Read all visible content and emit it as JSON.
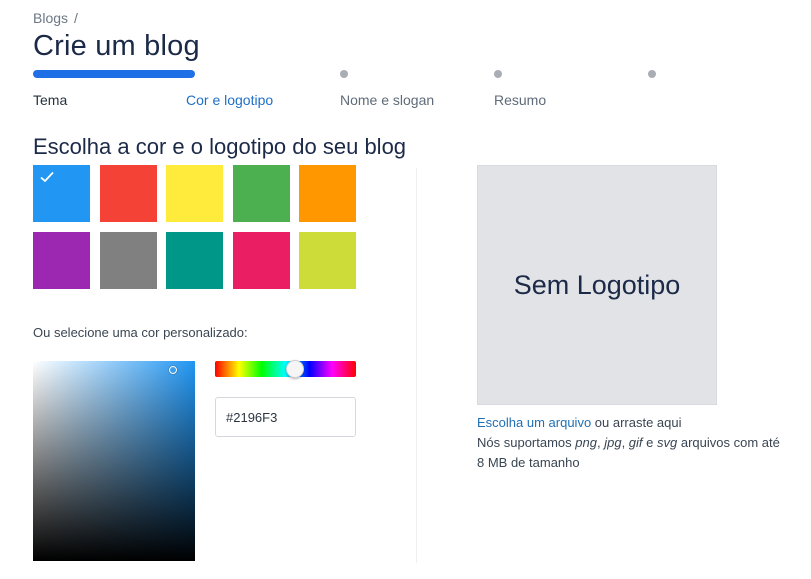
{
  "breadcrumb": {
    "item": "Blogs",
    "separator": "/"
  },
  "page_title": "Crie um blog",
  "steps": [
    {
      "label": "Tema",
      "state": "done"
    },
    {
      "label": "Cor e logotipo",
      "state": "active"
    },
    {
      "label": "Nome e slogan",
      "state": "upcoming"
    },
    {
      "label": "Resumo",
      "state": "upcoming"
    }
  ],
  "progress_fraction": 0.25,
  "section_title": "Escolha a cor e o logotipo do seu blog",
  "swatches": [
    {
      "color": "#2196F3",
      "selected": true
    },
    {
      "color": "#F44336",
      "selected": false
    },
    {
      "color": "#FFEB3B",
      "selected": false
    },
    {
      "color": "#4CAF50",
      "selected": false
    },
    {
      "color": "#FF9800",
      "selected": false
    },
    {
      "color": "#9C27B0",
      "selected": false
    },
    {
      "color": "#808080",
      "selected": false
    },
    {
      "color": "#009688",
      "selected": false
    },
    {
      "color": "#E91E63",
      "selected": false
    },
    {
      "color": "#CDDC39",
      "selected": false
    }
  ],
  "custom_color_label": "Ou selecione uma cor personalizado:",
  "hex_value": "#2196F3",
  "logo_placeholder": "Sem Logotipo",
  "upload": {
    "link": "Escolha um arquivo",
    "suffix": " ou arraste aqui",
    "line2_prefix": "Nós suportamos ",
    "fmt1": "png",
    "comma1": ", ",
    "fmt2": "jpg",
    "comma2": ", ",
    "fmt3": "gif",
    "and": " e ",
    "fmt4": "svg",
    "line2_suffix": " arquivos com até",
    "line3": "8 MB de tamanho"
  },
  "colors": {
    "accent": "#1F6FE6",
    "link": "#1F6FB4"
  }
}
